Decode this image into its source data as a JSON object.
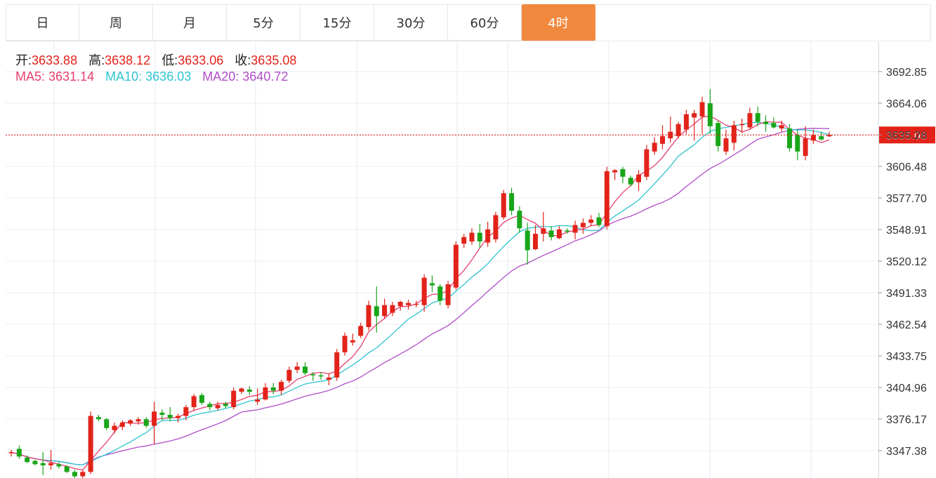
{
  "tabs": [
    {
      "label": "日",
      "active": false
    },
    {
      "label": "周",
      "active": false
    },
    {
      "label": "月",
      "active": false
    },
    {
      "label": "5分",
      "active": false
    },
    {
      "label": "15分",
      "active": false
    },
    {
      "label": "30分",
      "active": false
    },
    {
      "label": "60分",
      "active": false
    },
    {
      "label": "4时",
      "active": true
    }
  ],
  "ohlc_info": {
    "open_label": "开:",
    "open": "3633.88",
    "high_label": "高:",
    "high": "3638.12",
    "low_label": "低:",
    "low": "3633.06",
    "close_label": "收:",
    "close": "3635.08"
  },
  "ma_info": {
    "ma5_label": "MA5:",
    "ma5": "3631.14",
    "ma10_label": "MA10:",
    "ma10": "3636.03",
    "ma20_label": "MA20:",
    "ma20": "3640.72"
  },
  "colors": {
    "up": "#e2231a",
    "down": "#19a619",
    "ma5": "#e83e6f",
    "ma10": "#2ec4d0",
    "ma20": "#b04dc8",
    "active_tab": "#f0883e",
    "price_tag": "#e2231a"
  },
  "chart_data": {
    "type": "candlestick",
    "title": "",
    "y_ticks": [
      "3692.85",
      "3664.06",
      "3635.28",
      "3606.48",
      "3577.70",
      "3548.91",
      "3520.12",
      "3491.33",
      "3462.54",
      "3433.75",
      "3404.96",
      "3376.17",
      "3347.38"
    ],
    "ylim": [
      3320.0,
      3716.0
    ],
    "current_price": "3635.08",
    "grid": true,
    "candles": [
      [
        3345,
        3348,
        3342,
        3346
      ],
      [
        3349,
        3352,
        3340,
        3342
      ],
      [
        3341,
        3343,
        3336,
        3337
      ],
      [
        3338,
        3339,
        3334,
        3335
      ],
      [
        3336,
        3346,
        3325,
        3334
      ],
      [
        3334,
        3348,
        3330,
        3336
      ],
      [
        3335,
        3337,
        3331,
        3333
      ],
      [
        3333,
        3334,
        3327,
        3328
      ],
      [
        3328,
        3330,
        3322,
        3324
      ],
      [
        3324,
        3330,
        3318,
        3328
      ],
      [
        3328,
        3383,
        3326,
        3379
      ],
      [
        3378,
        3380,
        3374,
        3376
      ],
      [
        3376,
        3377,
        3366,
        3368
      ],
      [
        3366,
        3373,
        3363,
        3370
      ],
      [
        3369,
        3375,
        3366,
        3373
      ],
      [
        3372,
        3376,
        3370,
        3375
      ],
      [
        3374,
        3378,
        3371,
        3376
      ],
      [
        3376,
        3378,
        3368,
        3370
      ],
      [
        3370,
        3392,
        3353,
        3383
      ],
      [
        3382,
        3385,
        3375,
        3380
      ],
      [
        3380,
        3387,
        3374,
        3377
      ],
      [
        3377,
        3381,
        3373,
        3379
      ],
      [
        3379,
        3389,
        3375,
        3387
      ],
      [
        3387,
        3399,
        3384,
        3397
      ],
      [
        3398,
        3400,
        3389,
        3391
      ],
      [
        3390,
        3392,
        3384,
        3387
      ],
      [
        3386,
        3392,
        3384,
        3389
      ],
      [
        3390,
        3392,
        3386,
        3388
      ],
      [
        3387,
        3405,
        3385,
        3402
      ],
      [
        3401,
        3405,
        3399,
        3404
      ],
      [
        3403,
        3406,
        3398,
        3401
      ],
      [
        3392,
        3404,
        3389,
        3394
      ],
      [
        3394,
        3409,
        3393,
        3405
      ],
      [
        3405,
        3409,
        3399,
        3402
      ],
      [
        3402,
        3412,
        3398,
        3410
      ],
      [
        3411,
        3424,
        3409,
        3421
      ],
      [
        3421,
        3428,
        3418,
        3424
      ],
      [
        3424,
        3428,
        3416,
        3418
      ],
      [
        3417,
        3419,
        3411,
        3416
      ],
      [
        3416,
        3419,
        3412,
        3415
      ],
      [
        3412,
        3418,
        3407,
        3414
      ],
      [
        3414,
        3440,
        3411,
        3437
      ],
      [
        3437,
        3455,
        3434,
        3452
      ],
      [
        3446,
        3454,
        3443,
        3448
      ],
      [
        3452,
        3464,
        3450,
        3461
      ],
      [
        3460,
        3484,
        3457,
        3480
      ],
      [
        3479,
        3497,
        3455,
        3470
      ],
      [
        3470,
        3486,
        3468,
        3480
      ],
      [
        3473,
        3483,
        3470,
        3480
      ],
      [
        3479,
        3484,
        3475,
        3483
      ],
      [
        3480,
        3485,
        3476,
        3482
      ],
      [
        3481,
        3484,
        3478,
        3481
      ],
      [
        3480,
        3508,
        3474,
        3505
      ],
      [
        3500,
        3507,
        3492,
        3498
      ],
      [
        3497,
        3499,
        3480,
        3484
      ],
      [
        3480,
        3502,
        3477,
        3499
      ],
      [
        3496,
        3538,
        3494,
        3535
      ],
      [
        3536,
        3545,
        3532,
        3542
      ],
      [
        3538,
        3550,
        3535,
        3546
      ],
      [
        3546,
        3554,
        3532,
        3538
      ],
      [
        3537,
        3556,
        3533,
        3549
      ],
      [
        3540,
        3565,
        3537,
        3562
      ],
      [
        3560,
        3585,
        3558,
        3582
      ],
      [
        3582,
        3587,
        3562,
        3566
      ],
      [
        3566,
        3570,
        3546,
        3550
      ],
      [
        3548,
        3555,
        3517,
        3530
      ],
      [
        3531,
        3553,
        3530,
        3545
      ],
      [
        3545,
        3565,
        3538,
        3550
      ],
      [
        3548,
        3552,
        3539,
        3542
      ],
      [
        3541,
        3552,
        3540,
        3549
      ],
      [
        3548,
        3550,
        3545,
        3547
      ],
      [
        3546,
        3557,
        3540,
        3553
      ],
      [
        3551,
        3559,
        3545,
        3555
      ],
      [
        3555,
        3562,
        3552,
        3558
      ],
      [
        3560,
        3564,
        3551,
        3553
      ],
      [
        3552,
        3606,
        3549,
        3602
      ],
      [
        3601,
        3604,
        3594,
        3603
      ],
      [
        3604,
        3606,
        3591,
        3597
      ],
      [
        3596,
        3598,
        3588,
        3590
      ],
      [
        3592,
        3603,
        3584,
        3599
      ],
      [
        3597,
        3626,
        3594,
        3622
      ],
      [
        3620,
        3633,
        3617,
        3628
      ],
      [
        3627,
        3644,
        3622,
        3634
      ],
      [
        3632,
        3652,
        3628,
        3638
      ],
      [
        3634,
        3647,
        3632,
        3645
      ],
      [
        3640,
        3658,
        3636,
        3654
      ],
      [
        3651,
        3658,
        3630,
        3655
      ],
      [
        3652,
        3670,
        3636,
        3665
      ],
      [
        3664,
        3677,
        3636,
        3643
      ],
      [
        3646,
        3648,
        3620,
        3625
      ],
      [
        3620,
        3640,
        3617,
        3632
      ],
      [
        3628,
        3648,
        3621,
        3644
      ],
      [
        3644,
        3650,
        3637,
        3645
      ],
      [
        3642,
        3660,
        3640,
        3655
      ],
      [
        3655,
        3661,
        3643,
        3647
      ],
      [
        3647,
        3653,
        3638,
        3645
      ],
      [
        3646,
        3651,
        3641,
        3642
      ],
      [
        3641,
        3648,
        3638,
        3644
      ],
      [
        3641,
        3645,
        3620,
        3623
      ],
      [
        3635,
        3640,
        3612,
        3620
      ],
      [
        3616,
        3643,
        3612,
        3632
      ],
      [
        3630,
        3640,
        3627,
        3635
      ],
      [
        3634,
        3638,
        3630,
        3631
      ],
      [
        3633.88,
        3638.12,
        3633.06,
        3635.08
      ]
    ]
  }
}
